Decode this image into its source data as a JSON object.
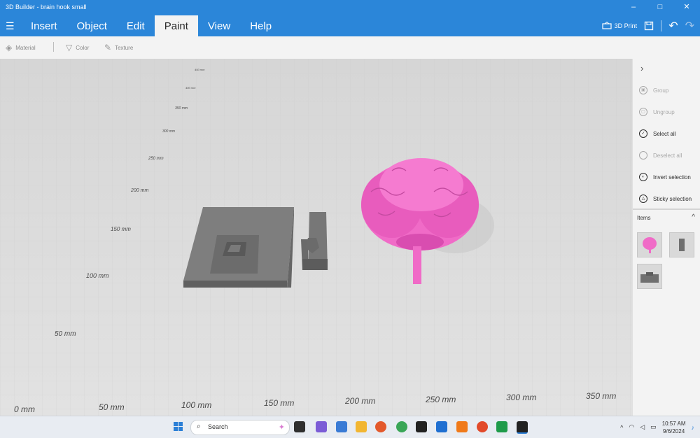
{
  "window": {
    "title": "3D Builder - brain hook small",
    "minimize": "–",
    "maximize": "□",
    "close": "✕"
  },
  "menu": {
    "items": [
      {
        "label": "Insert"
      },
      {
        "label": "Object"
      },
      {
        "label": "Edit"
      },
      {
        "label": "Paint"
      },
      {
        "label": "View"
      },
      {
        "label": "Help"
      }
    ],
    "active": "Paint",
    "print_label": "3D Print"
  },
  "toolbar": {
    "material": "Material",
    "color": "Color",
    "texture": "Texture"
  },
  "canvas": {
    "bottom_ruler": [
      "0 mm",
      "50 mm",
      "100 mm",
      "150 mm",
      "200 mm",
      "250 mm",
      "300 mm",
      "350 mm"
    ],
    "left_ruler": [
      "50 mm",
      "100 mm",
      "150 mm",
      "200 mm",
      "250 mm",
      "300 mm",
      "350 mm",
      "400 mm",
      "450 mm"
    ],
    "brain_color": "#f06bc7",
    "block_color": "#7b7b7b"
  },
  "panel": {
    "actions": [
      {
        "label": "Group",
        "enabled": false
      },
      {
        "label": "Ungroup",
        "enabled": false
      },
      {
        "label": "Select all",
        "enabled": true
      },
      {
        "label": "Deselect all",
        "enabled": false
      },
      {
        "label": "Invert selection",
        "enabled": true
      },
      {
        "label": "Sticky selection",
        "enabled": true
      }
    ],
    "items_label": "Items"
  },
  "taskbar": {
    "search_label": "Search",
    "time": "10:57 AM",
    "date": "9/6/2024"
  }
}
